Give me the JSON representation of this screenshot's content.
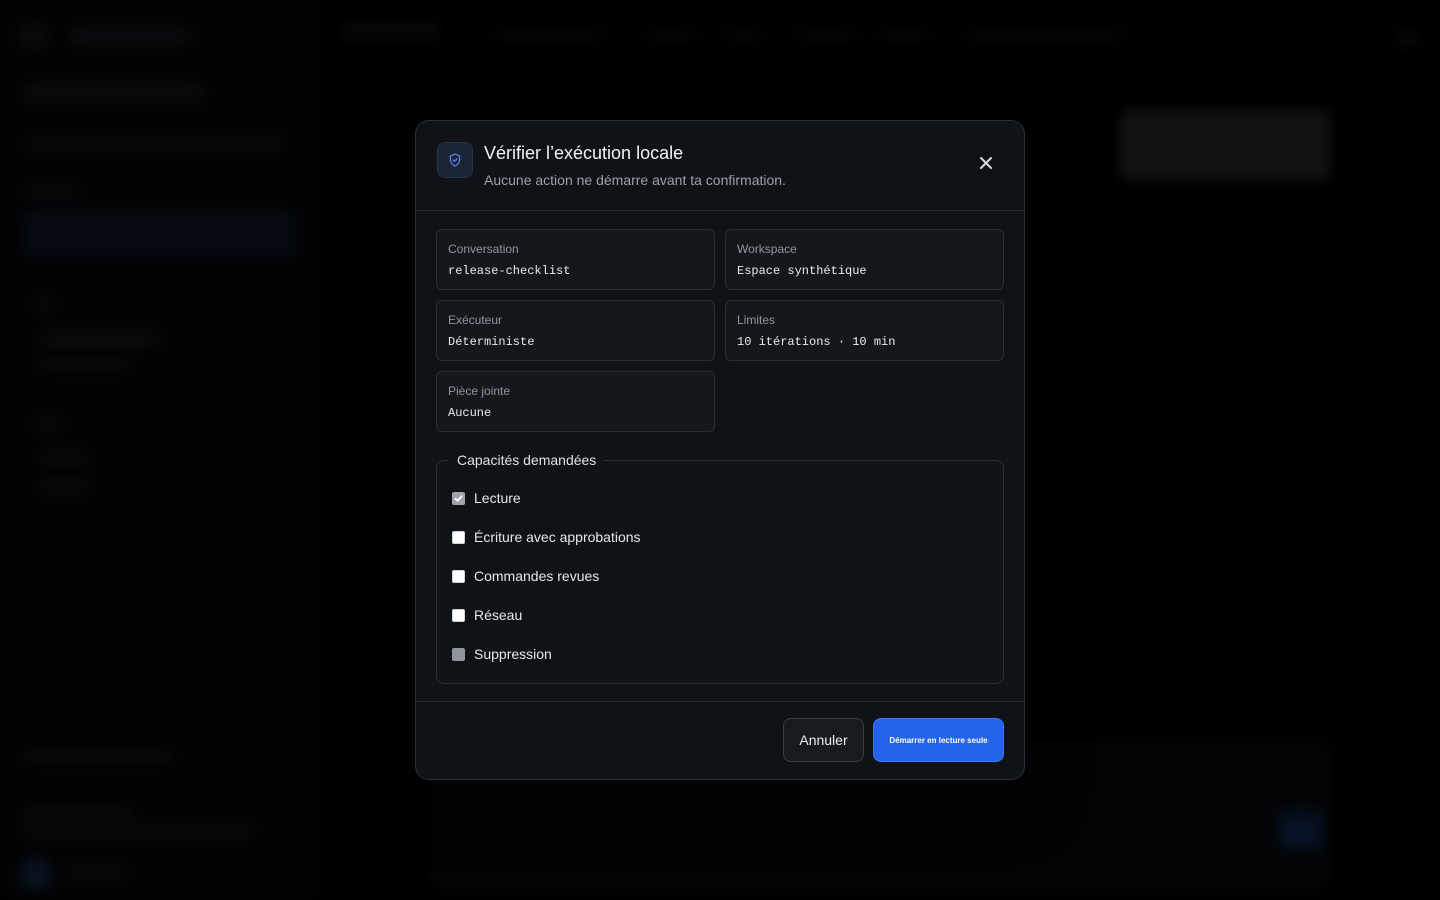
{
  "dialog": {
    "title": "Vérifier l’exécution locale",
    "subtitle": "Aucune action ne démarre avant ta confirmation.",
    "info": [
      {
        "label": "Conversation",
        "value": "release-checklist"
      },
      {
        "label": "Workspace",
        "value": "Espace synthétique"
      },
      {
        "label": "Exécuteur",
        "value": "Déterministe"
      },
      {
        "label": "Limites",
        "value": "10 itérations · 10 min"
      },
      {
        "label": "Pièce jointe",
        "value": "Aucune"
      }
    ],
    "capabilities": {
      "legend": "Capacités demandées",
      "items": [
        {
          "label": "Lecture",
          "checked": true,
          "disabled": true
        },
        {
          "label": "Écriture avec approbations",
          "checked": false,
          "disabled": false
        },
        {
          "label": "Commandes revues",
          "checked": false,
          "disabled": false
        },
        {
          "label": "Réseau",
          "checked": false,
          "disabled": false
        },
        {
          "label": "Suppression",
          "checked": false,
          "disabled": true
        }
      ]
    },
    "buttons": {
      "cancel": "Annuler",
      "start": "Démarrer en lecture seule"
    },
    "colors": {
      "primary": "#2563eb",
      "accent_icon": "#4f7df0"
    },
    "icons": {
      "header": "shield-check-icon",
      "close": "close-icon"
    }
  }
}
